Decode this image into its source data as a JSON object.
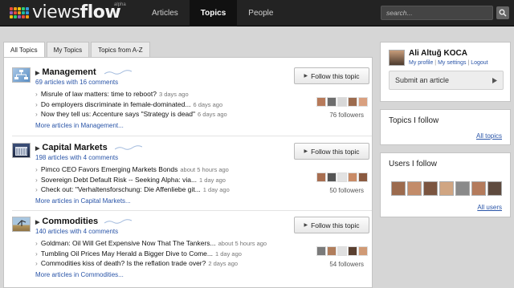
{
  "header": {
    "logo_text_views": "views",
    "logo_text_flow": "flow",
    "logo_badge": "alpha",
    "nav": [
      {
        "label": "Articles",
        "active": false
      },
      {
        "label": "Topics",
        "active": true
      },
      {
        "label": "People",
        "active": false
      }
    ],
    "search_placeholder": "search...",
    "search_icon": "search-icon"
  },
  "tabs": [
    {
      "label": "All Topics",
      "active": true
    },
    {
      "label": "My Topics",
      "active": false
    },
    {
      "label": "Topics from A-Z",
      "active": false
    }
  ],
  "topics": [
    {
      "title": "Management",
      "meta": "69 articles with 16 comments",
      "follow_label": "Follow this topic",
      "followers": "76 followers",
      "more": "More articles in Management...",
      "articles": [
        {
          "title": "Misrule of law matters: time to reboot?",
          "ago": "3 days ago"
        },
        {
          "title": "Do employers discriminate in female-dominated...",
          "ago": "6 days ago"
        },
        {
          "title": "Now they tell us: Accenture says \"Strategy is dead\"",
          "ago": "6 days ago"
        }
      ]
    },
    {
      "title": "Capital Markets",
      "meta": "198 articles with 4 comments",
      "follow_label": "Follow this topic",
      "followers": "50 followers",
      "more": "More articles in Capital Markets...",
      "articles": [
        {
          "title": "Pimco CEO Favors Emerging Markets Bonds",
          "ago": "about 5 hours ago"
        },
        {
          "title": "Sovereign Debt Default Risk -- Seeking Alpha: via...",
          "ago": "1 day ago"
        },
        {
          "title": "Check out: \"Verhaltensforschung: Die Affenliebe git...",
          "ago": "1 day ago"
        }
      ]
    },
    {
      "title": "Commodities",
      "meta": "140 articles with 4 comments",
      "follow_label": "Follow this topic",
      "followers": "54 followers",
      "more": "More articles in Commodities...",
      "articles": [
        {
          "title": "Goldman: Oil Will Get Expensive Now That The Tankers...",
          "ago": "about 5 hours ago"
        },
        {
          "title": "Tumbling Oil Prices May Herald a Bigger Dive to Come...",
          "ago": "1 day ago"
        },
        {
          "title": "Commodities kiss of death? Is the reflation trade over?",
          "ago": "2 days ago"
        }
      ]
    }
  ],
  "sidebar": {
    "user": {
      "name": "Ali Altuğ KOCA",
      "link_profile": "My profile",
      "link_settings": "My settings",
      "link_logout": "Logout",
      "separator": "|"
    },
    "submit_label": "Submit an article",
    "topics_box": {
      "title": "Topics I follow",
      "link": "All topics"
    },
    "users_box": {
      "title": "Users I follow",
      "link": "All users"
    }
  },
  "colors": {
    "topbar": "#232323",
    "link": "#2a55a8",
    "background": "#d6d6d6"
  }
}
